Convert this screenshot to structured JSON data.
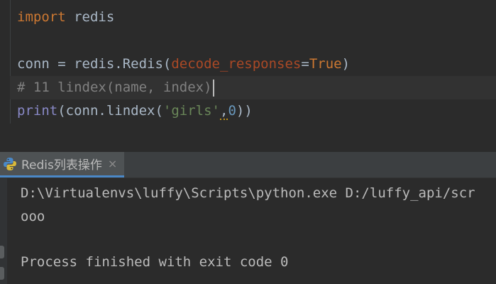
{
  "editor": {
    "line1": {
      "keyword": "import",
      "rest": " redis"
    },
    "line3": {
      "lhs": "conn = redis.Redis(",
      "param": "decode_responses",
      "eq": "=",
      "value": "True",
      "close": ")"
    },
    "line4": {
      "comment": "# 11 lindex(name, index)"
    },
    "line5": {
      "fn": "print",
      "open": "(conn.lindex(",
      "str": "'girls'",
      "comma": ",",
      "num": "0",
      "close": "))"
    }
  },
  "run_panel": {
    "tab_label": "Redis列表操作",
    "close_glyph": "×",
    "icon": "python-icon"
  },
  "console": {
    "lines": [
      "D:\\Virtualenvs\\luffy\\Scripts\\python.exe D:/luffy_api/scr",
      "ooo",
      "",
      "Process finished with exit code 0"
    ]
  },
  "colors": {
    "keyword": "#cc7832",
    "param": "#aa4926",
    "string": "#6a8759",
    "number": "#6897bb",
    "builtin": "#8888c6",
    "comment": "#808080",
    "background": "#2b2b2b"
  }
}
